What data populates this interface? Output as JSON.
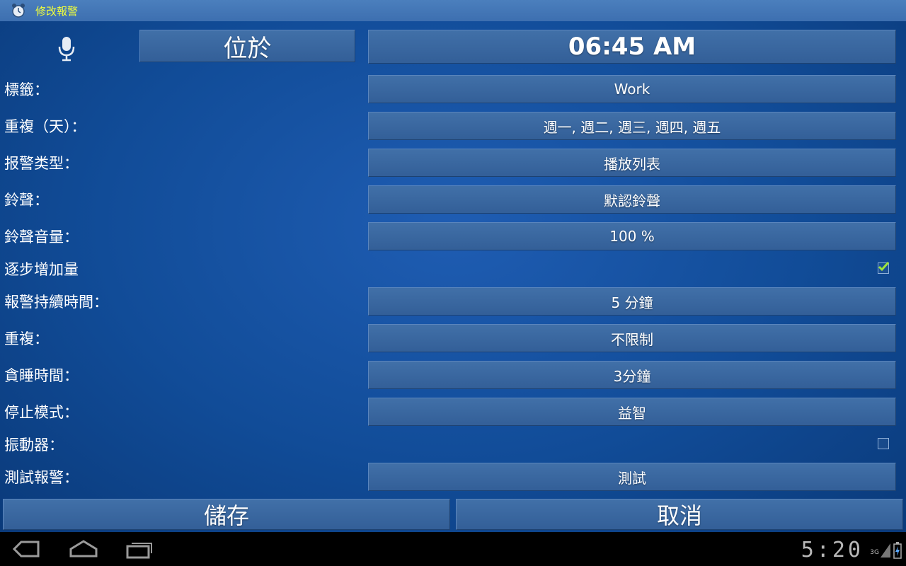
{
  "titlebar": {
    "title": "修改報警"
  },
  "header": {
    "mode_label": "位於",
    "time": "06:45 AM"
  },
  "rows": [
    {
      "label": "標籤：",
      "value": "Work"
    },
    {
      "label": "重複（天）：",
      "value": "週一, 週二, 週三, 週四, 週五"
    },
    {
      "label": "报警类型：",
      "value": "播放列表"
    },
    {
      "label": "鈴聲：",
      "value": "默認鈴聲"
    },
    {
      "label": "鈴聲音量：",
      "value": "100 %"
    },
    {
      "label": "逐步增加量",
      "checked": true
    },
    {
      "label": "報警持續時間：",
      "value": "5 分鐘"
    },
    {
      "label": "重複：",
      "value": "不限制"
    },
    {
      "label": "貪睡時間：",
      "value": "3分鐘"
    },
    {
      "label": "停止模式：",
      "value": "益智"
    },
    {
      "label": "振動器：",
      "checked": false
    },
    {
      "label": "測試報警：",
      "value": "測試"
    }
  ],
  "footer": {
    "save_label": "儲存",
    "cancel_label": "取消"
  },
  "status": {
    "clock": "5:20",
    "network": "3G"
  },
  "colors": {
    "title_text": "#f2ff3a",
    "check_mark": "#9ee33a"
  }
}
